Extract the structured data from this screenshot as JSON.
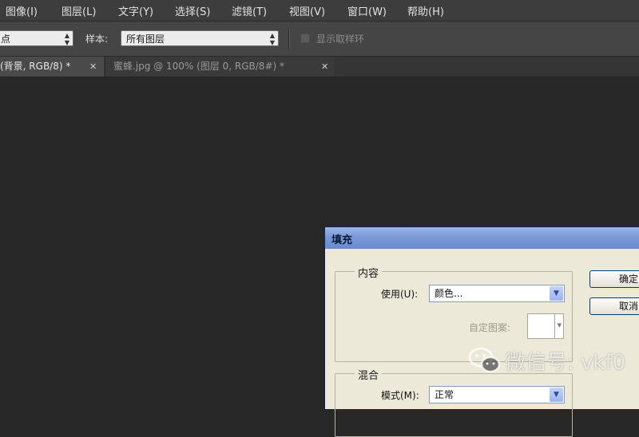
{
  "menubar": {
    "items": [
      "图像(I)",
      "图层(L)",
      "文字(Y)",
      "选择(S)",
      "滤镜(T)",
      "视图(V)",
      "窗口(W)",
      "帮助(H)"
    ]
  },
  "options": {
    "sample_size_value": "点",
    "sample_label": "样本:",
    "sample_value": "所有图层",
    "show_ring_label": "显示取样环"
  },
  "tabs": [
    {
      "label": "(背景, RGB/8) *",
      "active": true
    },
    {
      "label": "蜜蜂.jpg @ 100% (图层 0, RGB/8#) *",
      "active": false
    }
  ],
  "icons": {
    "close": "close-icon",
    "dropdown": "chevron-down-icon",
    "wechat": "wechat-icon"
  },
  "dialog": {
    "title": "填充",
    "content_group": {
      "title": "内容",
      "use_label": "使用(U):",
      "use_value": "颜色...",
      "pattern_label": "自定图案:"
    },
    "blend_group": {
      "title": "混合",
      "mode_label": "模式(M):",
      "mode_value": "正常"
    },
    "ok_button": "确定",
    "cancel_button": "取消"
  },
  "watermark": {
    "text": "微信号: vkf0"
  },
  "colors": {
    "background": "#282828",
    "titlebar": "#7a99d8",
    "dialog": "#ece9d8"
  }
}
